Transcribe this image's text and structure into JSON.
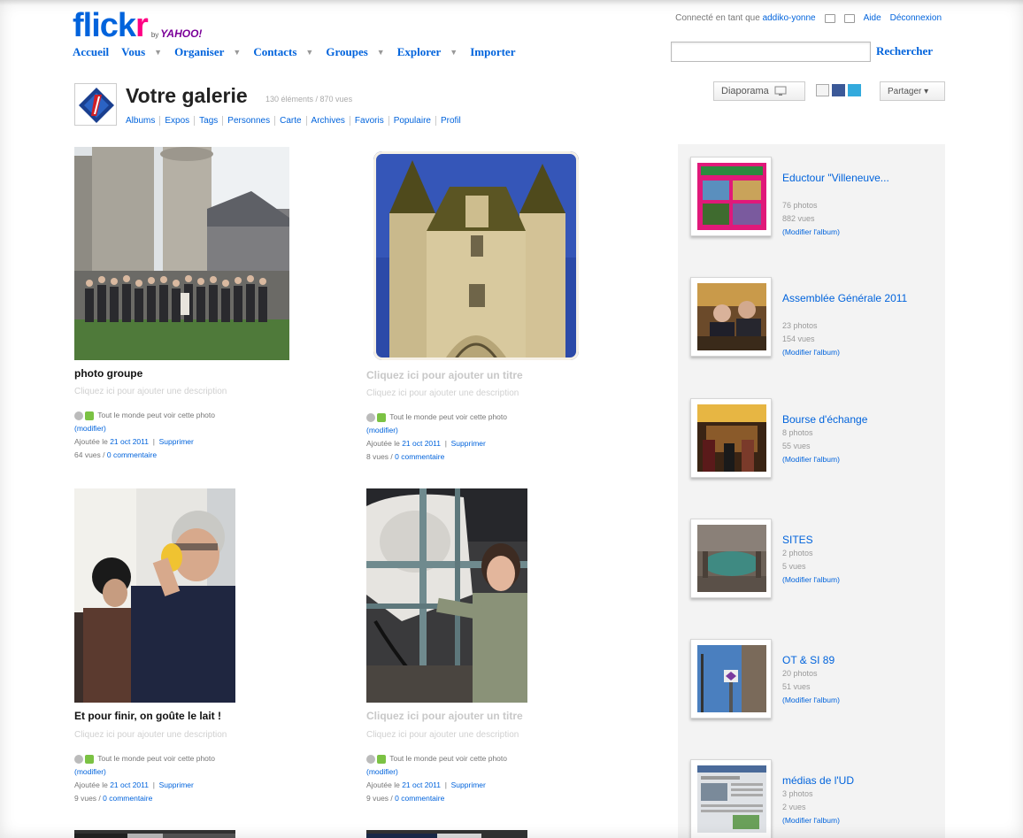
{
  "header": {
    "brand_main": "flick",
    "brand_accent": "r",
    "brand_by": "by",
    "brand_yahoo": "YAHOO!",
    "connected_prefix": "Connecté en tant que",
    "username": "addiko-yonne",
    "help": "Aide",
    "logout": "Déconnexion"
  },
  "nav": {
    "items": [
      {
        "label": "Accueil",
        "has_menu": false
      },
      {
        "label": "Vous",
        "has_menu": true
      },
      {
        "label": "Organiser",
        "has_menu": true
      },
      {
        "label": "Contacts",
        "has_menu": true
      },
      {
        "label": "Groupes",
        "has_menu": true
      },
      {
        "label": "Explorer",
        "has_menu": true
      },
      {
        "label": "Importer",
        "has_menu": false
      }
    ],
    "search_value": "",
    "search_button": "Rechercher"
  },
  "gallery": {
    "title": "Votre galerie",
    "stats": "130 éléments / 870 vues",
    "tabs": [
      "Albums",
      "Expos",
      "Tags",
      "Personnes",
      "Carte",
      "Archives",
      "Favoris",
      "Populaire",
      "Profil"
    ],
    "slideshow": "Diaporama",
    "share": "Partager ▾"
  },
  "photos": [
    {
      "title": "photo groupe",
      "title_placeholder": false,
      "description": "Cliquez ici pour ajouter une description",
      "privacy": "Tout le monde peut voir cette photo",
      "modify": "(modifier)",
      "added_prefix": "Ajoutée le",
      "date": "21 oct 2011",
      "delete": "Supprimer",
      "views": "64 vues",
      "comments": "0 commentaire"
    },
    {
      "title": "Cliquez ici pour ajouter un titre",
      "title_placeholder": true,
      "description": "Cliquez ici pour ajouter une description",
      "privacy": "Tout le monde peut voir cette photo",
      "modify": "(modifier)",
      "added_prefix": "Ajoutée le",
      "date": "21 oct 2011",
      "delete": "Supprimer",
      "views": "8 vues",
      "comments": "0 commentaire"
    },
    {
      "title": "Et pour finir, on goûte le lait !",
      "title_placeholder": false,
      "description": "Cliquez ici pour ajouter une description",
      "privacy": "Tout le monde peut voir cette photo",
      "modify": "(modifier)",
      "added_prefix": "Ajoutée le",
      "date": "21 oct 2011",
      "delete": "Supprimer",
      "views": "9 vues",
      "comments": "0 commentaire"
    },
    {
      "title": "Cliquez ici pour ajouter un titre",
      "title_placeholder": true,
      "description": "Cliquez ici pour ajouter une description",
      "privacy": "Tout le monde peut voir cette photo",
      "modify": "(modifier)",
      "added_prefix": "Ajoutée le",
      "date": "21 oct 2011",
      "delete": "Supprimer",
      "views": "9 vues",
      "comments": "0 commentaire"
    }
  ],
  "albums": [
    {
      "title": "Eductour \"Villeneuve...",
      "photos": "76 photos",
      "views": "882 vues",
      "edit": "(Modifier l'album)"
    },
    {
      "title": "Assemblée Générale 2011",
      "photos": "23 photos",
      "views": "154 vues",
      "edit": "(Modifier l'album)"
    },
    {
      "title": "Bourse d'échange",
      "photos": "8 photos",
      "views": "55 vues",
      "edit": "(Modifier l'album)"
    },
    {
      "title": "SITES",
      "photos": "2 photos",
      "views": "5 vues",
      "edit": "(Modifier l'album)"
    },
    {
      "title": "OT & SI 89",
      "photos": "20 photos",
      "views": "51 vues",
      "edit": "(Modifier l'album)"
    },
    {
      "title": "médias de l'UD",
      "photos": "3 photos",
      "views": "2 vues",
      "edit": "(Modifier l'album)"
    }
  ],
  "colors": {
    "link_blue": "#0063dc",
    "flickr_pink": "#ff0084",
    "sidebar_bg": "#f3f3f3"
  }
}
